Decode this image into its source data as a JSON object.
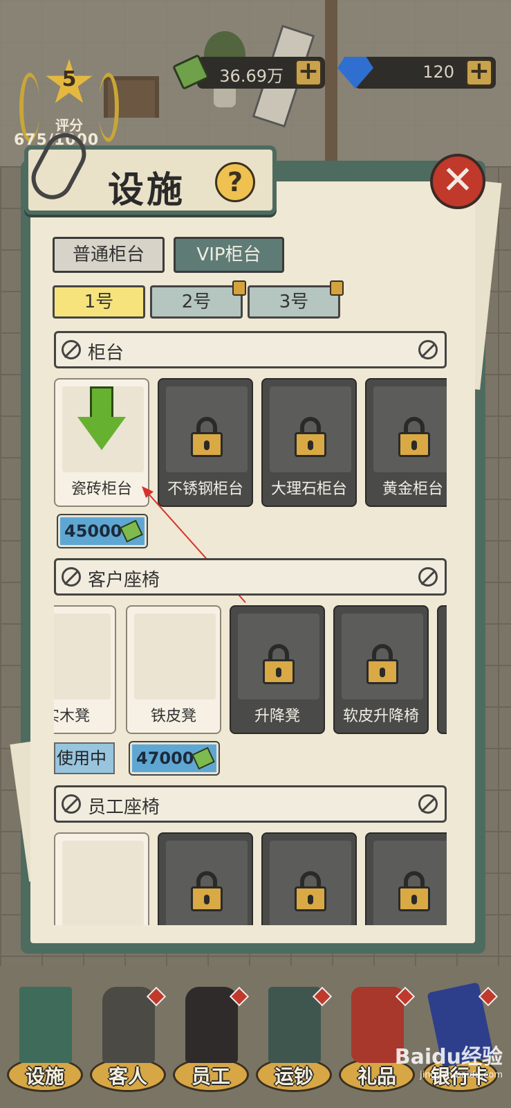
{
  "hud": {
    "rating_level": "5",
    "rating_label": "评分",
    "rating_score": "675/1000",
    "cash": "36.69万",
    "gems": "120",
    "plus": "+"
  },
  "dialog": {
    "title": "设施",
    "help": "?",
    "close": "✕",
    "tabs": {
      "normal": "普通柜台",
      "vip": "VIP柜台"
    },
    "subtabs": [
      "1号",
      "2号",
      "3号"
    ]
  },
  "sections": {
    "counter": {
      "label": "柜台",
      "items": [
        "瓷砖柜台",
        "不锈钢柜台",
        "大理石柜台",
        "黄金柜台"
      ],
      "price": "45000"
    },
    "customer_seat": {
      "label": "客户座椅",
      "items": [
        "实木凳",
        "铁皮凳",
        "升降凳",
        "软皮升降椅"
      ],
      "status": "使用中",
      "price": "47000"
    },
    "staff_seat": {
      "label": "员工座椅"
    }
  },
  "bottom_nav": [
    "设施",
    "客人",
    "员工",
    "运钞",
    "礼品",
    "银行卡"
  ],
  "watermark": {
    "brand": "Baidu经验",
    "url": "jingyan.baidu.com"
  },
  "colors": {
    "panel": "#efe8d4",
    "panel_border": "#4e6b60",
    "selected_tab": "#f7e37c",
    "price_bg": "#5fa7d3",
    "close_red": "#c0392b"
  }
}
